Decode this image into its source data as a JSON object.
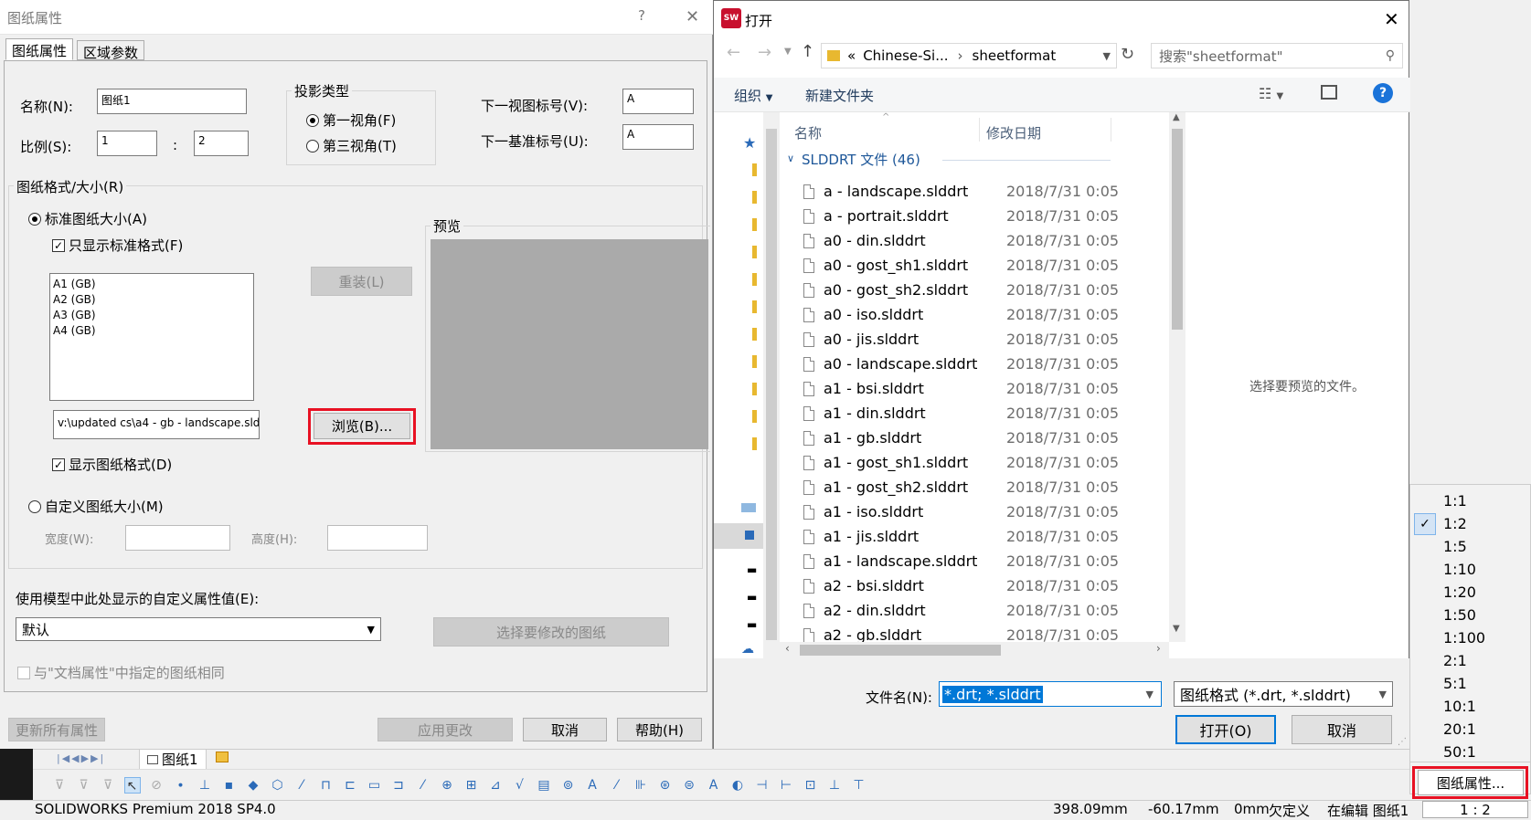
{
  "sheet_dialog": {
    "title": "图纸属性",
    "help": "?",
    "close": "✕",
    "tabs": [
      "图纸属性",
      "区域参数"
    ],
    "name_label": "名称(N):",
    "name_value": "图纸1",
    "scale_label": "比例(S):",
    "scale_left": "1",
    "scale_sep": ":",
    "scale_right": "2",
    "projection_title": "投影类型",
    "projection_first": "第一视角(F)",
    "projection_third": "第三视角(T)",
    "next_view_label": "下一视图标号(V):",
    "next_view_value": "A",
    "next_datum_label": "下一基准标号(U):",
    "next_datum_value": "A",
    "format_title": "图纸格式/大小(R)",
    "standard_size": "标准图纸大小(A)",
    "only_standard": "只显示标准格式(F)",
    "sizes": [
      "A1 (GB)",
      "A2 (GB)",
      "A3 (GB)",
      "A4 (GB)"
    ],
    "reload_btn": "重装(L)",
    "path_value": "v:\\updated cs\\a4 - gb - landscape.sld",
    "browse_btn": "浏览(B)...",
    "show_format": "显示图纸格式(D)",
    "preview_title": "预览",
    "custom_size": "自定义图纸大小(M)",
    "width_label": "宽度(W):",
    "height_label": "高度(H):",
    "custom_prop_label": "使用模型中此处显示的自定义属性值(E):",
    "custom_prop_value": "默认",
    "select_sheet_btn": "选择要修改的图纸",
    "same_as_doc": "与\"文档属性\"中指定的图纸相同",
    "update_all_btn": "更新所有属性",
    "apply_btn": "应用更改",
    "cancel_btn": "取消",
    "help_btn": "帮助(H)"
  },
  "open_dialog": {
    "title": "打开",
    "close": "✕",
    "breadcrumb_prefix": "«",
    "breadcrumb_parent": "Chinese-Si...",
    "breadcrumb_current": "sheetformat",
    "search_placeholder": "搜索\"sheetformat\"",
    "organize": "组织",
    "new_folder": "新建文件夹",
    "col_name": "名称",
    "col_date": "修改日期",
    "group_label": "SLDDRT 文件 (46)",
    "files": [
      {
        "name": "a - landscape.slddrt",
        "date": "2018/7/31 0:05"
      },
      {
        "name": "a - portrait.slddrt",
        "date": "2018/7/31 0:05"
      },
      {
        "name": "a0 - din.slddrt",
        "date": "2018/7/31 0:05"
      },
      {
        "name": "a0 - gost_sh1.slddrt",
        "date": "2018/7/31 0:05"
      },
      {
        "name": "a0 - gost_sh2.slddrt",
        "date": "2018/7/31 0:05"
      },
      {
        "name": "a0 - iso.slddrt",
        "date": "2018/7/31 0:05"
      },
      {
        "name": "a0 - jis.slddrt",
        "date": "2018/7/31 0:05"
      },
      {
        "name": "a0 - landscape.slddrt",
        "date": "2018/7/31 0:05"
      },
      {
        "name": "a1 - bsi.slddrt",
        "date": "2018/7/31 0:05"
      },
      {
        "name": "a1 - din.slddrt",
        "date": "2018/7/31 0:05"
      },
      {
        "name": "a1 - gb.slddrt",
        "date": "2018/7/31 0:05"
      },
      {
        "name": "a1 - gost_sh1.slddrt",
        "date": "2018/7/31 0:05"
      },
      {
        "name": "a1 - gost_sh2.slddrt",
        "date": "2018/7/31 0:05"
      },
      {
        "name": "a1 - iso.slddrt",
        "date": "2018/7/31 0:05"
      },
      {
        "name": "a1 - jis.slddrt",
        "date": "2018/7/31 0:05"
      },
      {
        "name": "a1 - landscape.slddrt",
        "date": "2018/7/31 0:05"
      },
      {
        "name": "a2 - bsi.slddrt",
        "date": "2018/7/31 0:05"
      },
      {
        "name": "a2 - din.slddrt",
        "date": "2018/7/31 0:05"
      },
      {
        "name": "a2 - gb.slddrt",
        "date": "2018/7/31 0:05"
      }
    ],
    "preview_hint": "选择要预览的文件。",
    "filename_label": "文件名(N):",
    "filename_value": "*.drt; *.slddrt",
    "filetype_value": "图纸格式 (*.drt, *.slddrt)",
    "open_btn": "打开(O)",
    "cancel_btn": "取消"
  },
  "scale_menu": {
    "items": [
      "1:1",
      "1:2",
      "1:5",
      "1:10",
      "1:20",
      "1:50",
      "1:100",
      "2:1",
      "5:1",
      "10:1",
      "20:1",
      "50:1"
    ],
    "checked": "1:2",
    "sheet_props": "图纸属性..."
  },
  "sw": {
    "sheet_tab": "图纸1",
    "status_app": "SOLIDWORKS Premium 2018 SP4.0",
    "status_x": "398.09mm",
    "status_y": "-60.17mm",
    "status_z": "0mm",
    "status_def": "欠定义",
    "status_edit": "在编辑 图纸1",
    "status_scale": "1 : 2"
  },
  "colors": {
    "accent": "#0078d7",
    "highlight": "#e81123"
  }
}
